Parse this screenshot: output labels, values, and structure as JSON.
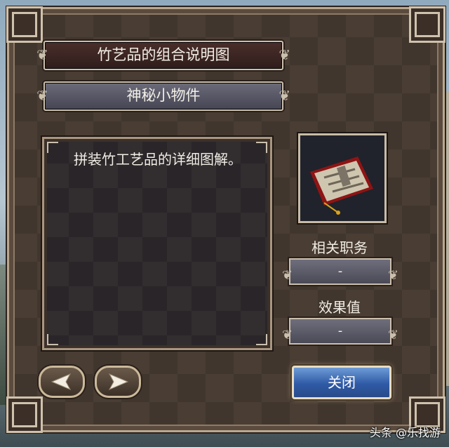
{
  "dialog": {
    "item_title": "竹艺品的组合说明图",
    "item_category": "神秘小物件",
    "description": "拼装竹工艺品的详细图解。",
    "item_icon": "scroll-icon"
  },
  "stats": {
    "related_job_label": "相关职务",
    "related_job_value": "-",
    "effect_label": "效果值",
    "effect_value": "-"
  },
  "buttons": {
    "prev_icon": "left-arrow-icon",
    "next_icon": "right-arrow-icon",
    "close_label": "关闭"
  },
  "watermark": "头条 @乐找游",
  "colors": {
    "panel": "#4a3d33",
    "frame": "#cbbfae",
    "close_button": "#2f5aa6"
  }
}
